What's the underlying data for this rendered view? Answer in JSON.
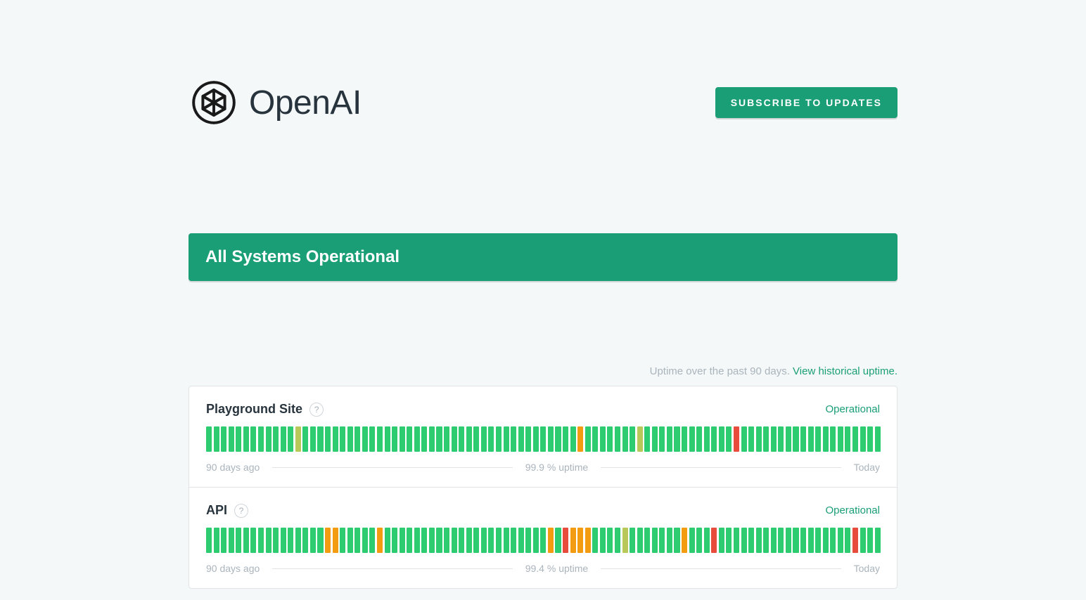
{
  "header": {
    "brand": "OpenAI",
    "subscribe_label": "SUBSCRIBE TO UPDATES"
  },
  "banner": {
    "text": "All Systems Operational"
  },
  "uptime_note": {
    "prefix": "Uptime over the past 90 days. ",
    "link": "View historical uptime."
  },
  "legend": {
    "left": "90 days ago",
    "right": "Today"
  },
  "components": [
    {
      "name": "Playground Site",
      "status": "Operational",
      "uptime": "99.9 % uptime",
      "days": "ggggggggggggygggggggggggggggggggggggggggggggggggggogggggggyggggggggggggrggggggggggggggggggg"
    },
    {
      "name": "API",
      "status": "Operational",
      "uptime": "99.4 % uptime",
      "days": "ggggggggggggggggoogggggoggggggggggggggggggggggogroooggggygggggggogggrggggggggggggggggggrggg"
    }
  ]
}
